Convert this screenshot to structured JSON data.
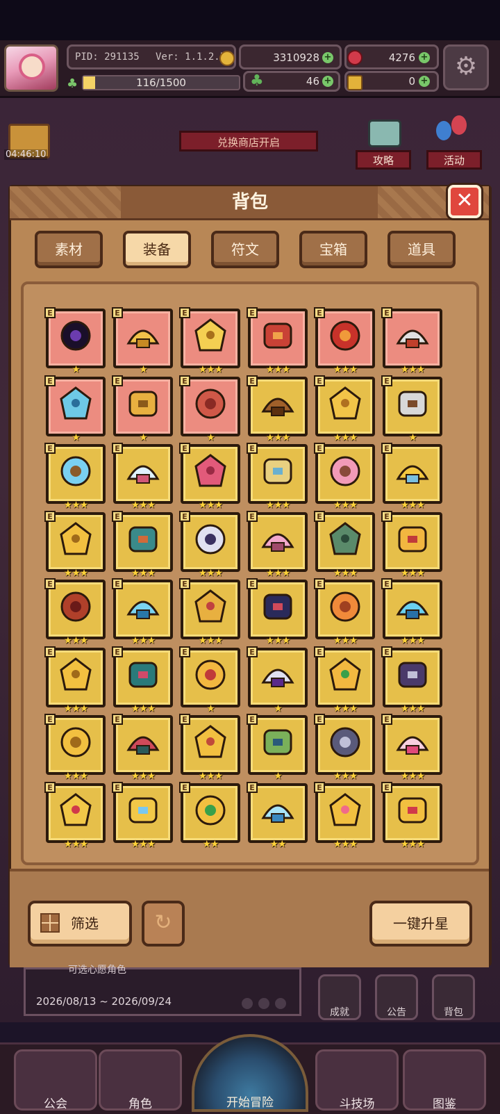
{
  "hud": {
    "pid": "PID: 291135",
    "version": "Ver: 1.1.2.5",
    "gold": "3310928",
    "gems": "4276",
    "exp_text": "116/1500",
    "exp_fraction": 0.077,
    "clover": "46",
    "key": "0"
  },
  "scene": {
    "gift_timer": "04:46:10",
    "shop_banner": "兑换商店开启",
    "strategy": "攻略",
    "activity": "活动"
  },
  "bag": {
    "title": "背包",
    "tabs": [
      {
        "label": "素材",
        "active": false
      },
      {
        "label": "装备",
        "active": true
      },
      {
        "label": "符文",
        "active": false
      },
      {
        "label": "宝箱",
        "active": false
      },
      {
        "label": "道具",
        "active": false
      }
    ],
    "tag_letter": "E",
    "items": [
      {
        "icon": "dark-orb-icon",
        "bg": "red",
        "stars": 1
      },
      {
        "icon": "straw-hat-icon",
        "bg": "red",
        "stars": 1
      },
      {
        "icon": "gold-amulet-icon",
        "bg": "red",
        "stars": 3
      },
      {
        "icon": "red-bracer-icon",
        "bg": "red",
        "stars": 3
      },
      {
        "icon": "crossed-claws-icon",
        "bg": "red",
        "stars": 3
      },
      {
        "icon": "battle-axe-icon",
        "bg": "red",
        "stars": 3
      },
      {
        "icon": "crystal-helmet-icon",
        "bg": "red",
        "stars": 1
      },
      {
        "icon": "horned-circlet-icon",
        "bg": "red",
        "stars": 1
      },
      {
        "icon": "red-cloak-icon",
        "bg": "red",
        "stars": 1
      },
      {
        "icon": "wooden-staff-icon",
        "bg": "gold",
        "stars": 3
      },
      {
        "icon": "golden-scepter-icon",
        "bg": "gold",
        "stars": 3
      },
      {
        "icon": "short-sword-icon",
        "bg": "gold",
        "stars": 1
      },
      {
        "icon": "blue-wand-icon",
        "bg": "gold",
        "stars": 3
      },
      {
        "icon": "crystal-wand-icon",
        "bg": "gold",
        "stars": 3
      },
      {
        "icon": "bear-costume-icon",
        "bg": "gold",
        "stars": 3
      },
      {
        "icon": "knight-helm-icon",
        "bg": "gold",
        "stars": 3
      },
      {
        "icon": "pig-hood-icon",
        "bg": "gold",
        "stars": 3
      },
      {
        "icon": "gold-crown-icon",
        "bg": "gold",
        "stars": 3
      },
      {
        "icon": "gold-ring-crown-icon",
        "bg": "gold",
        "stars": 3
      },
      {
        "icon": "horned-helmet-icon",
        "bg": "gold",
        "stars": 3
      },
      {
        "icon": "winged-helm-icon",
        "bg": "gold",
        "stars": 3
      },
      {
        "icon": "pink-robe-icon",
        "bg": "gold",
        "stars": 3
      },
      {
        "icon": "green-armor-icon",
        "bg": "gold",
        "stars": 3
      },
      {
        "icon": "gold-armor-icon",
        "bg": "gold",
        "stars": 3
      },
      {
        "icon": "red-armor-icon",
        "bg": "gold",
        "stars": 3
      },
      {
        "icon": "ice-armor-icon",
        "bg": "gold",
        "stars": 3
      },
      {
        "icon": "gauntlet-icon",
        "bg": "gold",
        "stars": 3
      },
      {
        "icon": "dark-glove-icon",
        "bg": "gold",
        "stars": 3
      },
      {
        "icon": "orange-glove-icon",
        "bg": "gold",
        "stars": 3
      },
      {
        "icon": "ice-glove-icon",
        "bg": "gold",
        "stars": 3
      },
      {
        "icon": "gold-belt-icon",
        "bg": "gold",
        "stars": 3
      },
      {
        "icon": "teal-belt-icon",
        "bg": "gold",
        "stars": 3
      },
      {
        "icon": "ruby-belt-icon",
        "bg": "gold",
        "stars": 1
      },
      {
        "icon": "amethyst-ring-icon",
        "bg": "gold",
        "stars": 1
      },
      {
        "icon": "emerald-belt-icon",
        "bg": "gold",
        "stars": 3
      },
      {
        "icon": "shadow-belt-icon",
        "bg": "gold",
        "stars": 3
      },
      {
        "icon": "gold-boots-icon",
        "bg": "gold",
        "stars": 3
      },
      {
        "icon": "red-boots-icon",
        "bg": "gold",
        "stars": 3
      },
      {
        "icon": "yellow-boots-icon",
        "bg": "gold",
        "stars": 3
      },
      {
        "icon": "green-boots-icon",
        "bg": "gold",
        "stars": 1
      },
      {
        "icon": "iron-boots-icon",
        "bg": "gold",
        "stars": 3
      },
      {
        "icon": "pink-charm-icon",
        "bg": "gold",
        "stars": 3
      },
      {
        "icon": "ruby-amulet-icon",
        "bg": "gold",
        "stars": 3
      },
      {
        "icon": "sword-emblem-icon",
        "bg": "gold",
        "stars": 3
      },
      {
        "icon": "jeweled-amulet-icon",
        "bg": "gold",
        "stars": 2
      },
      {
        "icon": "ice-crystal-icon",
        "bg": "gold",
        "stars": 2
      },
      {
        "icon": "heart-necklace-icon",
        "bg": "gold",
        "stars": 3
      },
      {
        "icon": "gold-necklace-icon",
        "bg": "gold",
        "stars": 3
      }
    ],
    "filter_label": "筛选",
    "star_up_label": "一键升星"
  },
  "event": {
    "desc": "可选心愿角色",
    "date": "2026/08/13 ~ 2026/09/24"
  },
  "side": {
    "achievement": "成就",
    "notice": "公告",
    "bag": "背包"
  },
  "nav": {
    "guild": "公会",
    "character": "角色",
    "adventure": "开始冒险",
    "arena": "斗技场",
    "codex": "图鉴"
  },
  "colors": {
    "panel": "#b88756",
    "gold_slot": "#e6bf4a",
    "red_slot": "#ec8c80",
    "close": "#e0473d",
    "star": "#ffd23a"
  }
}
